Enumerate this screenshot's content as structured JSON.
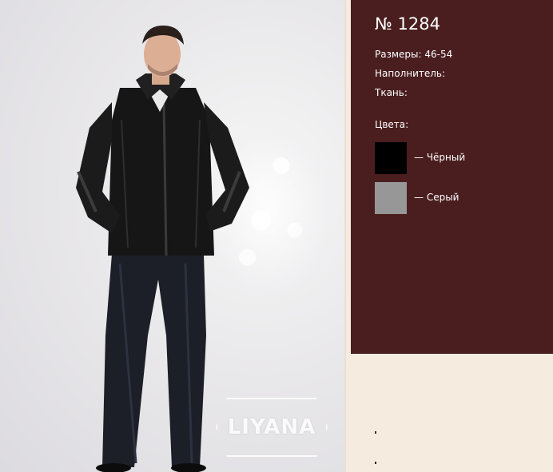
{
  "product": {
    "title": "№ 1284",
    "sizes": "Размеры: 46-54",
    "filler": "Наполнитель:",
    "fabric": "Ткань:",
    "colors_heading": "Цвета:",
    "colors": [
      {
        "label": "— Чёрный",
        "hex": "#000000"
      },
      {
        "label": "— Серый",
        "hex": "#979797"
      }
    ]
  },
  "photo": {
    "logo_text": "LIYANA",
    "logo_mark": "®"
  },
  "theme": {
    "panel_color": "#4a1e1f",
    "page_background": "#f5ebde"
  }
}
